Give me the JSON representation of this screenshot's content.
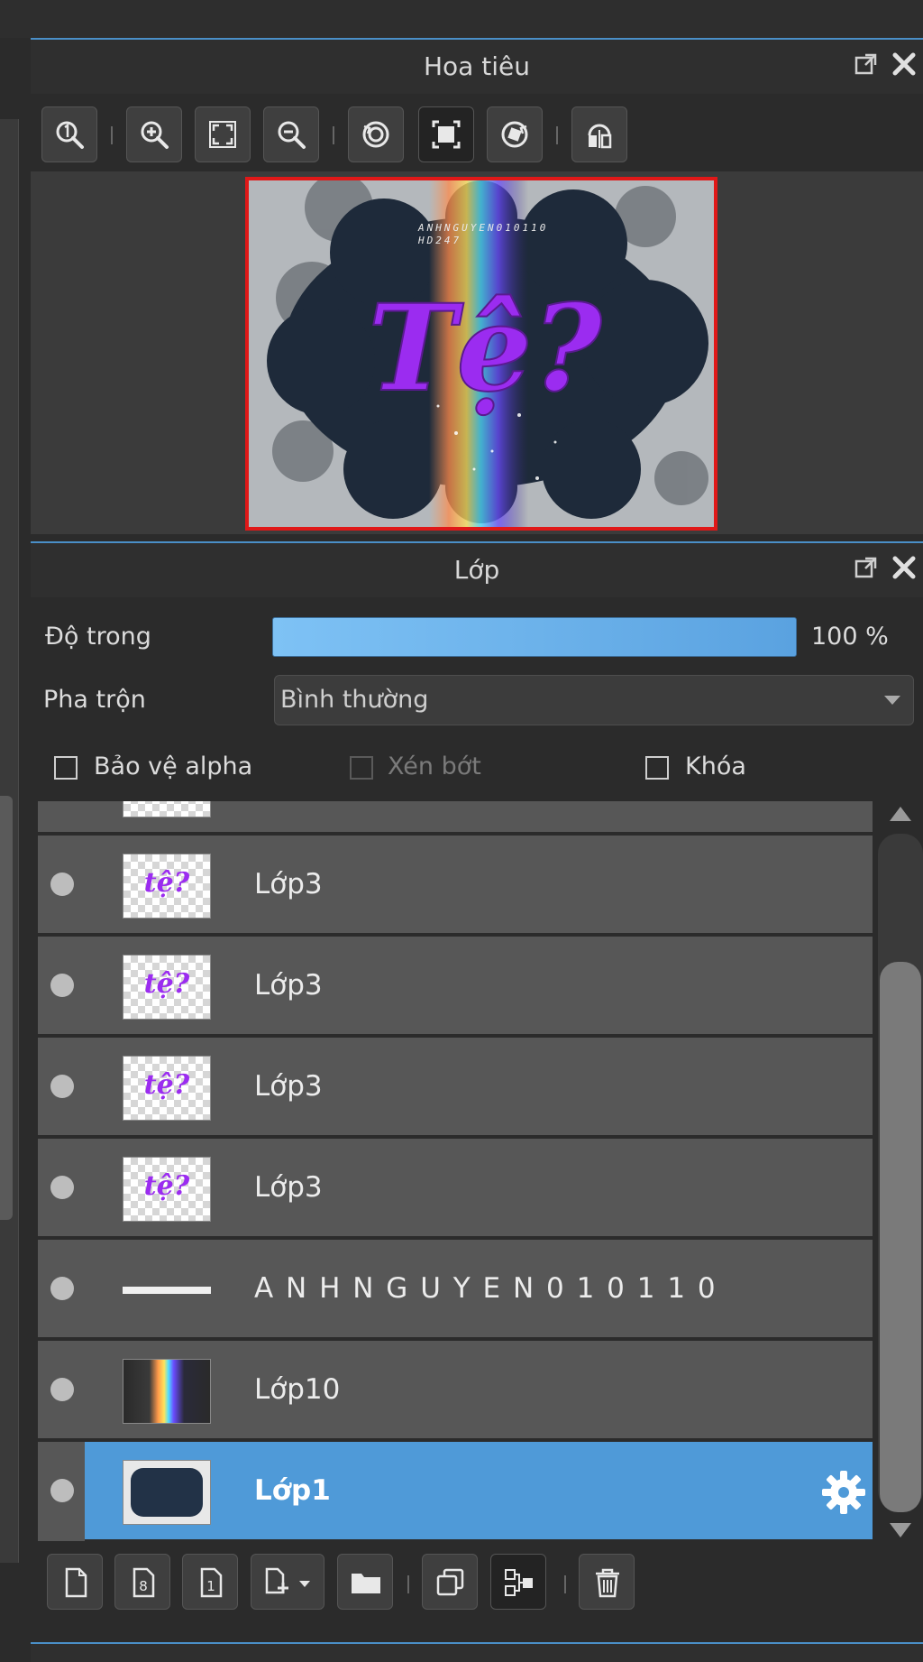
{
  "navigator": {
    "title": "Hoa tiêu",
    "toolbar": [
      "zoom-actual-icon",
      "zoom-in-icon",
      "fit-screen-icon",
      "zoom-out-icon",
      "rotate-left-icon",
      "fit-window-icon",
      "rotate-right-icon",
      "flip-horizontal-icon"
    ],
    "preview": {
      "heading": "Tệ?",
      "small_text_line1": "ANHNGUYEN010110",
      "small_text_line2": "HD247"
    }
  },
  "layers_panel": {
    "title": "Lớp",
    "opacity_label": "Độ trong",
    "opacity_value": "100 %",
    "opacity_fraction": 1.0,
    "blend_label": "Pha trộn",
    "blend_value": "Bình thường",
    "protect_alpha_label": "Bảo vệ alpha",
    "clip_label": "Xén bớt",
    "lock_label": "Khóa",
    "layers": [
      {
        "name": "Lớp3",
        "thumb_text": "tệ?"
      },
      {
        "name": "Lớp3",
        "thumb_text": "tệ?"
      },
      {
        "name": "Lớp3",
        "thumb_text": "tệ?"
      },
      {
        "name": "Lớp3",
        "thumb_text": "tệ?"
      },
      {
        "name": "A N H N G U Y E N 0 1 0 1 1 0"
      },
      {
        "name": "Lớp10"
      },
      {
        "name": "Lớp1",
        "selected": true
      }
    ],
    "bottom_toolbar": [
      "new-layer-icon",
      "new-8bit-layer-icon",
      "new-1bit-layer-icon",
      "new-layer-menu-icon",
      "new-folder-icon",
      "duplicate-layer-icon",
      "merge-layer-icon",
      "delete-layer-icon"
    ]
  },
  "colors": {
    "accent": "#4f9ad8",
    "preview_border": "#e01818",
    "heading_purple": "#9b2cf0"
  }
}
